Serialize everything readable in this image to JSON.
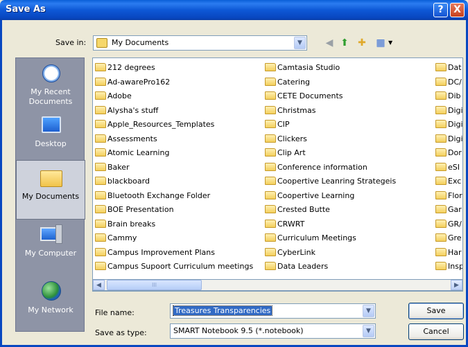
{
  "window": {
    "title": "Save As",
    "help_label": "?",
    "close_label": "X"
  },
  "toolbar": {
    "save_in_label": "Save in:",
    "save_in_value": "My Documents",
    "combo_arrow": "▼",
    "back_icon": "back-icon",
    "up_icon": "up-folder-icon",
    "new_folder_icon": "new-folder-icon",
    "views_icon": "views-menu-icon"
  },
  "places": [
    {
      "label": "My Recent Documents",
      "icon": "recent-documents-icon"
    },
    {
      "label": "Desktop",
      "icon": "desktop-icon"
    },
    {
      "label": "My Documents",
      "icon": "my-documents-icon",
      "selected": true
    },
    {
      "label": "My Computer",
      "icon": "my-computer-icon"
    },
    {
      "label": "My Network",
      "icon": "my-network-icon"
    }
  ],
  "files": {
    "columns": [
      [
        "212 degrees",
        "Ad-awarePro162",
        "Adobe",
        "Alysha's stuff",
        "Apple_Resources_Templates",
        "Assessments",
        "Atomic Learning",
        "Baker",
        "blackboard",
        "Bluetooth Exchange Folder",
        "BOE Presentation",
        "Brain breaks",
        "Cammy",
        "Campus Improvement Plans",
        "Campus Supoort Curriculum meetings"
      ],
      [
        "Camtasia Studio",
        "Catering",
        "CETE Documents",
        "Christmas",
        "CIP",
        "Clickers",
        "Clip Art",
        "Conference information",
        "Coopertive Leanring Strategeis",
        "Coopertive Learning",
        "Crested Butte",
        "CRWRT",
        "Curriculum Meetings",
        "CyberLink",
        "Data Leaders"
      ],
      [
        "Dat",
        "DC/",
        "Dib",
        "Digi",
        "Digi",
        "Digi",
        "Dor",
        "eSI",
        "Exc",
        "Flor",
        "Gar",
        "GR/",
        "Gre",
        "Har",
        "Insp"
      ]
    ]
  },
  "scrollbar": {
    "left_arrow": "◀",
    "right_arrow": "▶",
    "thumb_grip": "III"
  },
  "form": {
    "file_name_label": "File name:",
    "file_name_value": "Treasures Transparencies",
    "save_as_type_label": "Save as type:",
    "save_as_type_value": "SMART Notebook 9.5 (*.notebook)",
    "save_button": "Save",
    "cancel_button": "Cancel"
  }
}
